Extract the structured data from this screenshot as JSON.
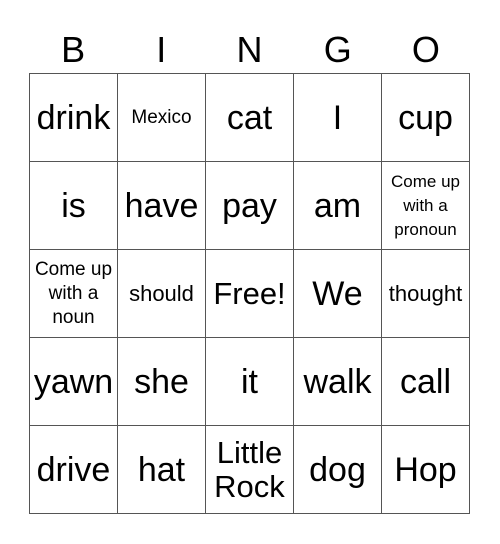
{
  "header": [
    "B",
    "I",
    "N",
    "G",
    "O"
  ],
  "cells": [
    [
      {
        "text": "drink",
        "size": "xl"
      },
      {
        "text": "Mexico",
        "size": "xs"
      },
      {
        "text": "cat",
        "size": "xl"
      },
      {
        "text": "I",
        "size": "xl"
      },
      {
        "text": "cup",
        "size": "xl"
      }
    ],
    [
      {
        "text": "is",
        "size": "xl"
      },
      {
        "text": "have",
        "size": "xl"
      },
      {
        "text": "pay",
        "size": "xl"
      },
      {
        "text": "am",
        "size": "xl"
      },
      {
        "text": "Come up with a pronoun",
        "size": "xxs"
      }
    ],
    [
      {
        "text": "Come up with a noun",
        "size": "xs"
      },
      {
        "text": "should",
        "size": "s"
      },
      {
        "text": "Free!",
        "size": "l"
      },
      {
        "text": "We",
        "size": "xl"
      },
      {
        "text": "thought",
        "size": "s"
      }
    ],
    [
      {
        "text": "yawn",
        "size": "xl"
      },
      {
        "text": "she",
        "size": "xl"
      },
      {
        "text": "it",
        "size": "xl"
      },
      {
        "text": "walk",
        "size": "xl"
      },
      {
        "text": "call",
        "size": "xl"
      }
    ],
    [
      {
        "text": "drive",
        "size": "xl"
      },
      {
        "text": "hat",
        "size": "xl"
      },
      {
        "text": "Little Rock",
        "size": "l"
      },
      {
        "text": "dog",
        "size": "xl"
      },
      {
        "text": "Hop",
        "size": "xl"
      }
    ]
  ]
}
